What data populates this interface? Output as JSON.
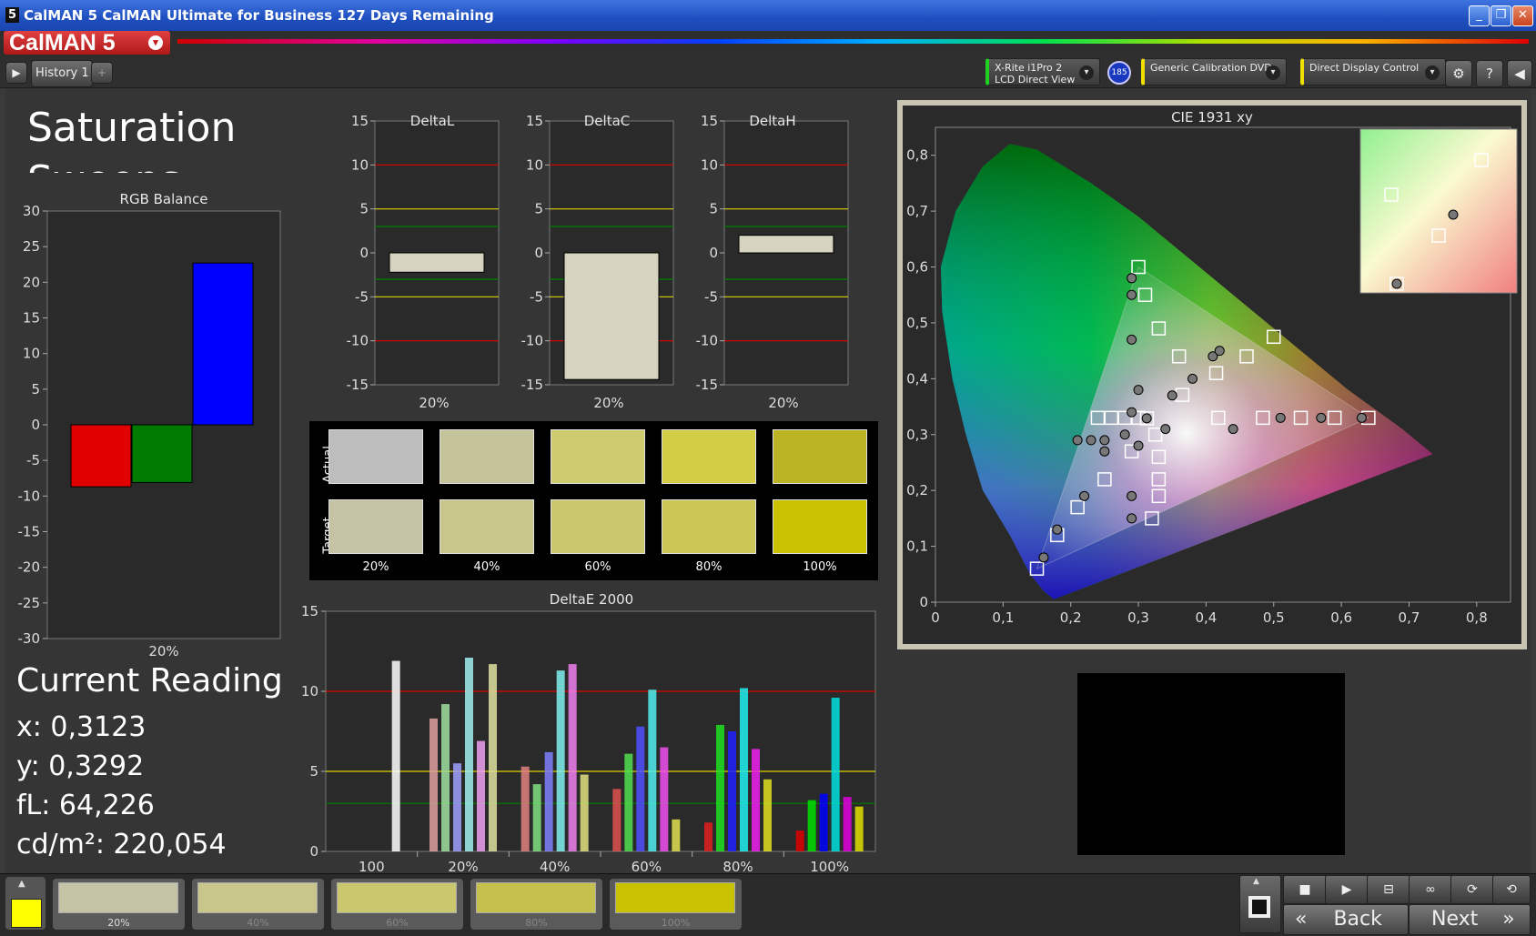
{
  "window": {
    "title": "CalMAN 5 CalMAN Ultimate for Business 127 Days Remaining",
    "app_icon": "5",
    "minimize": "_",
    "maximize": "❐",
    "close": "✕"
  },
  "logo": {
    "text": "CalMAN 5",
    "dropdown": "▾"
  },
  "tabs": [
    {
      "label": "History 1",
      "add": "+"
    }
  ],
  "devices": {
    "meter": {
      "line1": "X-Rite i1Pro 2",
      "line2": "LCD Direct View",
      "badge": "185"
    },
    "source": {
      "label": "Generic Calibration DVD"
    },
    "display": {
      "label": "Direct Display Control"
    }
  },
  "icons": {
    "settings": "gear-icon",
    "help": "help-icon",
    "collapse": "chevron-left-icon"
  },
  "page": {
    "title_line1": "Saturation",
    "title_line2": "Sweeps"
  },
  "rgb_balance": {
    "title": "RGB Balance",
    "y_ticks": [
      "30",
      "25",
      "20",
      "15",
      "10",
      "5",
      "0",
      "-5",
      "-10",
      "-15",
      "-20",
      "-25",
      "-30"
    ],
    "x_label": "20%"
  },
  "deltas": [
    {
      "title": "DeltaL",
      "x_label": "20%"
    },
    {
      "title": "DeltaC",
      "x_label": "20%"
    },
    {
      "title": "DeltaH",
      "x_label": "20%"
    }
  ],
  "delta_ticks": [
    "15",
    "10",
    "5",
    "0",
    "-5",
    "-10",
    "-15"
  ],
  "swatches": {
    "row_labels": {
      "actual": "Actual",
      "target": "Target"
    },
    "columns": [
      "20%",
      "40%",
      "60%",
      "80%",
      "100%"
    ],
    "actual_colors": [
      "#bdbdbd",
      "#c4c39a",
      "#cfcc70",
      "#d3cd45",
      "#bab425"
    ],
    "target_colors": [
      "#c4c3a6",
      "#c9c68c",
      "#cac76f",
      "#cbc655",
      "#c8c200"
    ]
  },
  "deltae": {
    "title": "DeltaE 2000",
    "y_ticks": [
      "15",
      "10",
      "5",
      "0"
    ],
    "groups": [
      "100",
      "20%",
      "40%",
      "60%",
      "80%",
      "100%"
    ]
  },
  "cie": {
    "title": "CIE 1931 xy",
    "x_ticks": [
      "0",
      "0,1",
      "0,2",
      "0,3",
      "0,4",
      "0,5",
      "0,6",
      "0,7",
      "0,8"
    ],
    "y_ticks": [
      "0,8",
      "0,7",
      "0,6",
      "0,5",
      "0,4",
      "0,3",
      "0,2",
      "0,1",
      "0"
    ]
  },
  "current_reading": {
    "title": "Current Reading",
    "x": "x: 0,3123",
    "y": "y: 0,3292",
    "fl": "fL: 64,226",
    "cdm2": "cd/m²: 220,054"
  },
  "bottom": {
    "swatches": [
      {
        "label": "20%",
        "color": "#c4c3a6"
      },
      {
        "label": "40%",
        "color": "#c9c68c"
      },
      {
        "label": "60%",
        "color": "#cac76f"
      },
      {
        "label": "80%",
        "color": "#c6c04d"
      },
      {
        "label": "100%",
        "color": "#c8c200"
      }
    ],
    "active_color": "#ffff00",
    "back": "Back",
    "next": "Next"
  },
  "chart_data": [
    {
      "type": "bar",
      "title": "RGB Balance",
      "categories": [
        "20%"
      ],
      "series": [],
      "values_by_channel": {
        "red": -8.7,
        "green": -8.1,
        "blue": 22.7
      },
      "ylim": [
        -30,
        30
      ],
      "colors": {
        "red": "#e00000",
        "green": "#007a00",
        "blue": "#0000ff"
      }
    },
    {
      "type": "bar",
      "title": "DeltaL",
      "categories": [
        "20%"
      ],
      "values": [
        -2.2
      ],
      "ylim": [
        -15,
        15
      ],
      "reference_lines": [
        10,
        5,
        3,
        -3,
        -5,
        -10
      ]
    },
    {
      "type": "bar",
      "title": "DeltaC",
      "categories": [
        "20%"
      ],
      "values": [
        -14.4
      ],
      "ylim": [
        -15,
        15
      ],
      "reference_lines": [
        10,
        5,
        3,
        -3,
        -5,
        -10
      ]
    },
    {
      "type": "bar",
      "title": "DeltaH",
      "categories": [
        "20%"
      ],
      "values": [
        2.0
      ],
      "ylim": [
        -15,
        15
      ],
      "reference_lines": [
        10,
        5,
        3,
        -3,
        -5,
        -10
      ]
    },
    {
      "type": "bar",
      "title": "DeltaE 2000",
      "categories": [
        "100",
        "20%",
        "40%",
        "60%",
        "80%",
        "100%"
      ],
      "bars": [
        [
          {
            "v": 11.9,
            "c": "#ffffff"
          }
        ],
        [
          {
            "v": 8.3,
            "c": "#e0a0a0"
          },
          {
            "v": 9.2,
            "c": "#a0e0a0"
          },
          {
            "v": 5.5,
            "c": "#a0a0ff"
          },
          {
            "v": 12.1,
            "c": "#a0f0f0"
          },
          {
            "v": 6.9,
            "c": "#f0a0f0"
          },
          {
            "v": 11.7,
            "c": "#e0e0a0"
          }
        ],
        [
          {
            "v": 5.3,
            "c": "#e08080"
          },
          {
            "v": 4.2,
            "c": "#80e080"
          },
          {
            "v": 6.2,
            "c": "#8080ff"
          },
          {
            "v": 11.3,
            "c": "#80f0f0"
          },
          {
            "v": 11.7,
            "c": "#f080f0"
          },
          {
            "v": 4.8,
            "c": "#e0e080"
          }
        ],
        [
          {
            "v": 3.9,
            "c": "#e05050"
          },
          {
            "v": 6.1,
            "c": "#50e050"
          },
          {
            "v": 7.8,
            "c": "#5050ff"
          },
          {
            "v": 10.1,
            "c": "#50f0f0"
          },
          {
            "v": 6.5,
            "c": "#f050f0"
          },
          {
            "v": 2.0,
            "c": "#e0e050"
          }
        ],
        [
          {
            "v": 1.8,
            "c": "#e02020"
          },
          {
            "v": 7.9,
            "c": "#20e020"
          },
          {
            "v": 7.5,
            "c": "#2020ff"
          },
          {
            "v": 10.2,
            "c": "#20f0f0"
          },
          {
            "v": 6.4,
            "c": "#f020f0"
          },
          {
            "v": 4.5,
            "c": "#e0e020"
          }
        ],
        [
          {
            "v": 1.3,
            "c": "#e00000"
          },
          {
            "v": 3.2,
            "c": "#00e000"
          },
          {
            "v": 3.6,
            "c": "#0000ff"
          },
          {
            "v": 9.6,
            "c": "#00e0e0"
          },
          {
            "v": 3.4,
            "c": "#e000e0"
          },
          {
            "v": 2.8,
            "c": "#e0e000"
          }
        ]
      ],
      "ylim": [
        0,
        15
      ],
      "reference_lines": [
        10,
        5,
        3
      ]
    },
    {
      "type": "scatter",
      "title": "CIE 1931 xy",
      "xlim": [
        0,
        0.85
      ],
      "ylim": [
        0,
        0.85
      ],
      "gamut_triangle": [
        [
          0.64,
          0.33
        ],
        [
          0.3,
          0.6
        ],
        [
          0.15,
          0.06
        ]
      ],
      "targets": [
        [
          0.3127,
          0.329
        ],
        [
          0.365,
          0.371
        ],
        [
          0.415,
          0.41
        ],
        [
          0.46,
          0.44
        ],
        [
          0.5,
          0.475
        ],
        [
          0.36,
          0.44
        ],
        [
          0.33,
          0.49
        ],
        [
          0.31,
          0.55
        ],
        [
          0.3,
          0.6
        ],
        [
          0.418,
          0.33
        ],
        [
          0.484,
          0.33
        ],
        [
          0.54,
          0.33
        ],
        [
          0.59,
          0.33
        ],
        [
          0.64,
          0.33
        ],
        [
          0.29,
          0.27
        ],
        [
          0.25,
          0.22
        ],
        [
          0.21,
          0.17
        ],
        [
          0.18,
          0.12
        ],
        [
          0.15,
          0.06
        ],
        [
          0.325,
          0.3
        ],
        [
          0.33,
          0.26
        ],
        [
          0.33,
          0.22
        ],
        [
          0.33,
          0.19
        ],
        [
          0.32,
          0.15
        ],
        [
          0.3,
          0.33
        ],
        [
          0.28,
          0.33
        ],
        [
          0.26,
          0.33
        ],
        [
          0.24,
          0.33
        ]
      ],
      "measured": [
        [
          0.3123,
          0.3292
        ],
        [
          0.35,
          0.37
        ],
        [
          0.38,
          0.4
        ],
        [
          0.41,
          0.44
        ],
        [
          0.42,
          0.45
        ],
        [
          0.3,
          0.38
        ],
        [
          0.29,
          0.47
        ],
        [
          0.29,
          0.55
        ],
        [
          0.29,
          0.58
        ],
        [
          0.44,
          0.31
        ],
        [
          0.51,
          0.33
        ],
        [
          0.57,
          0.33
        ],
        [
          0.63,
          0.33
        ],
        [
          0.25,
          0.27
        ],
        [
          0.22,
          0.19
        ],
        [
          0.18,
          0.13
        ],
        [
          0.16,
          0.08
        ],
        [
          0.23,
          0.29
        ],
        [
          0.21,
          0.29
        ],
        [
          0.25,
          0.29
        ],
        [
          0.28,
          0.3
        ],
        [
          0.29,
          0.34
        ],
        [
          0.3,
          0.28
        ],
        [
          0.29,
          0.19
        ],
        [
          0.29,
          0.15
        ],
        [
          0.34,
          0.31
        ]
      ]
    }
  ]
}
